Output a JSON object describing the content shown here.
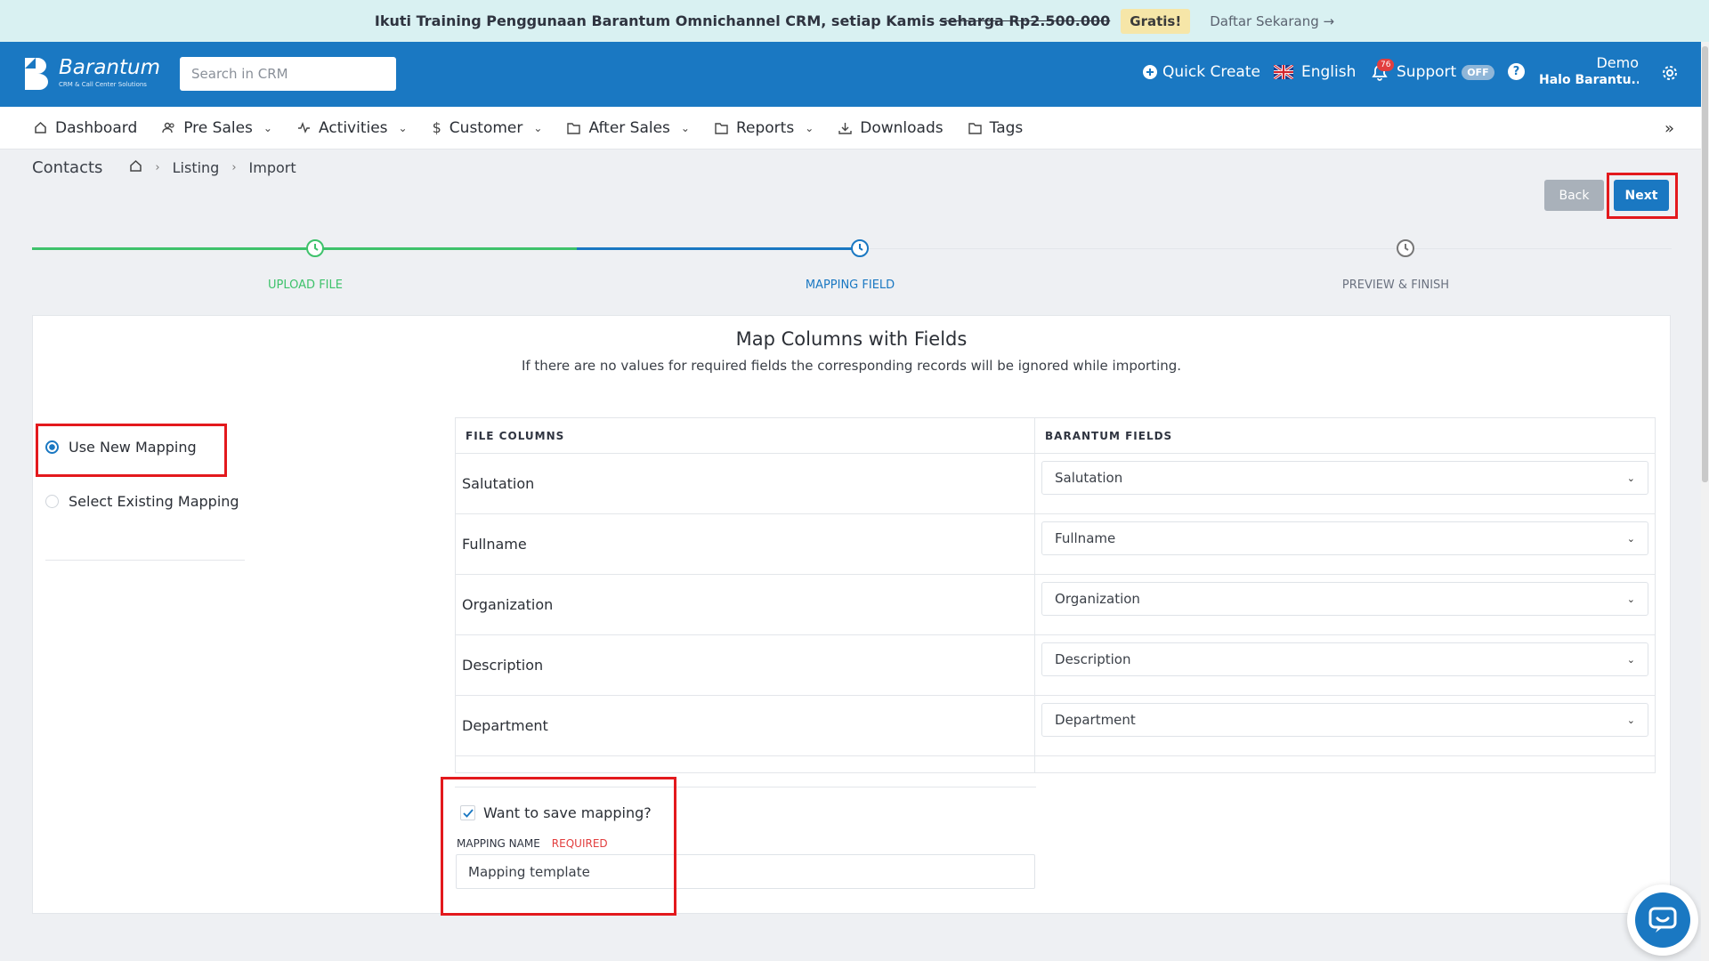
{
  "promo": {
    "text": "Ikuti Training Penggunaan Barantum Omnichannel CRM, setiap Kamis",
    "strike_price": "seharga Rp2.500.000",
    "badge": "Gratis!",
    "link": "Daftar Sekarang →"
  },
  "header": {
    "logo_name": "Barantum",
    "logo_sub": "CRM & Call Center Solutions",
    "search_placeholder": "Search in CRM",
    "quick_create": "Quick Create",
    "language": "English",
    "notif_count": "76",
    "support": "Support",
    "support_status": "OFF",
    "user_name": "Demo",
    "user_greeting": "Halo Barantu..."
  },
  "nav": {
    "items": [
      {
        "label": "Dashboard",
        "icon": "home-icon"
      },
      {
        "label": "Pre Sales",
        "icon": "users-icon"
      },
      {
        "label": "Activities",
        "icon": "activity-icon"
      },
      {
        "label": "Customer",
        "icon": "dollar-icon"
      },
      {
        "label": "After Sales",
        "icon": "folder-icon"
      },
      {
        "label": "Reports",
        "icon": "folder-icon"
      },
      {
        "label": "Downloads",
        "icon": "download-icon"
      },
      {
        "label": "Tags",
        "icon": "folder-icon"
      }
    ],
    "more": "»"
  },
  "breadcrumb": {
    "title": "Contacts",
    "home_icon": "home-icon",
    "listing": "Listing",
    "import": "Import"
  },
  "actions": {
    "back": "Back",
    "next": "Next"
  },
  "stepper": {
    "steps": [
      {
        "label": "UPLOAD FILE",
        "state": "done"
      },
      {
        "label": "MAPPING FIELD",
        "state": "active"
      },
      {
        "label": "PREVIEW & FINISH",
        "state": "pending"
      }
    ]
  },
  "card": {
    "title": "Map Columns with Fields",
    "subtitle": "If there are no values for required fields the corresponding records will be ignored while importing.",
    "mapping_options": {
      "new": "Use New Mapping",
      "existing": "Select Existing Mapping"
    },
    "table": {
      "headers": [
        "FILE COLUMNS",
        "BARANTUM FIELDS"
      ],
      "rows": [
        {
          "file_column": "Salutation",
          "field": "Salutation"
        },
        {
          "file_column": "Fullname",
          "field": "Fullname"
        },
        {
          "file_column": "Organization",
          "field": "Organization"
        },
        {
          "file_column": "Description",
          "field": "Description"
        },
        {
          "file_column": "Department",
          "field": "Department"
        }
      ]
    },
    "save": {
      "checkbox_label": "Want to save mapping?",
      "field_label": "MAPPING NAME",
      "required": "REQUIRED",
      "input_value": "Mapping template"
    }
  },
  "colors": {
    "brand": "#1a78c2",
    "done_green": "#3ec26b",
    "highlight_red": "#e3191d"
  }
}
